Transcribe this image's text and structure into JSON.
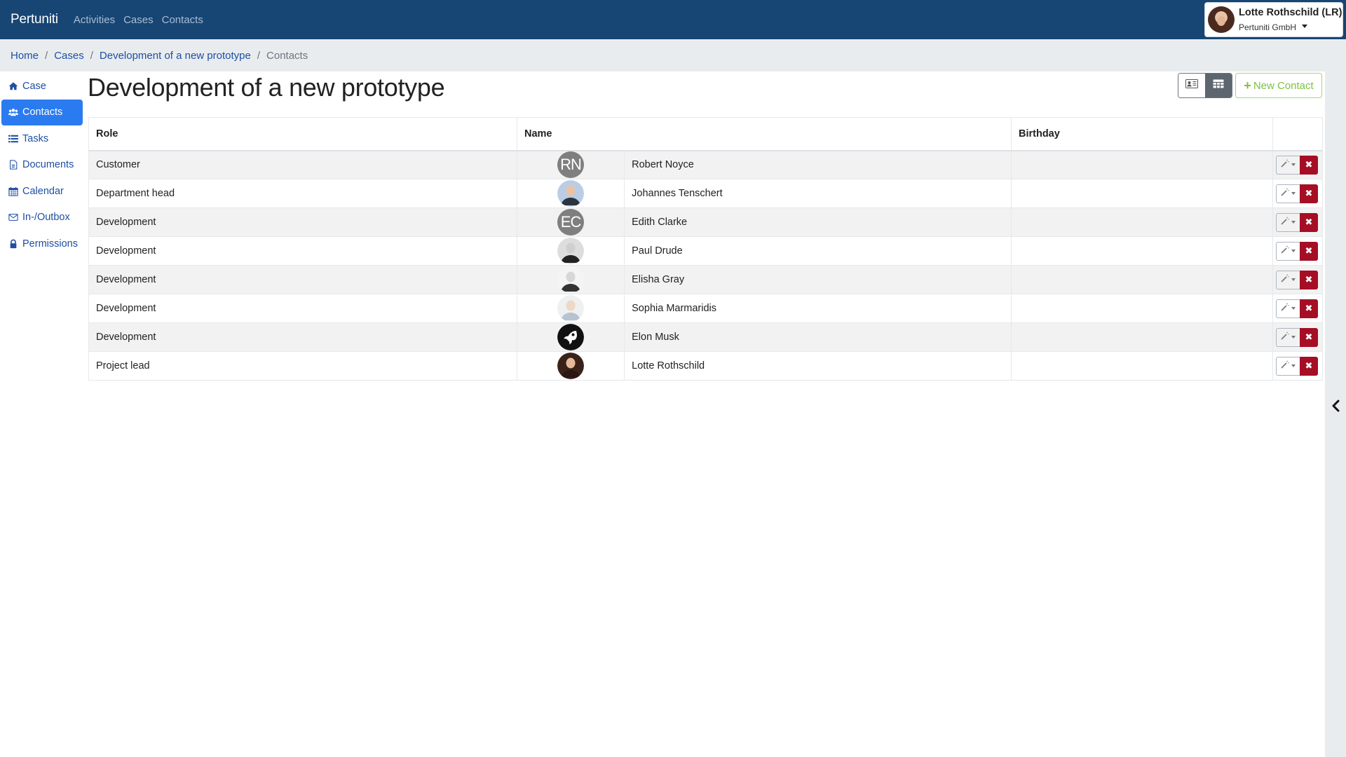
{
  "navbar": {
    "brand": "Pertuniti",
    "links": [
      "Activities",
      "Cases",
      "Contacts"
    ],
    "user": {
      "name": "Lotte Rothschild (LR)",
      "organization": "Pertuniti GmbH"
    }
  },
  "breadcrumb": {
    "items": [
      "Home",
      "Cases",
      "Development of a new prototype"
    ],
    "current": "Contacts",
    "separator": "/"
  },
  "sidebar": {
    "items": [
      {
        "label": "Case",
        "icon": "home-icon",
        "active": false
      },
      {
        "label": "Contacts",
        "icon": "users-icon",
        "active": true
      },
      {
        "label": "Tasks",
        "icon": "list-icon",
        "active": false
      },
      {
        "label": "Documents",
        "icon": "document-icon",
        "active": false
      },
      {
        "label": "Calendar",
        "icon": "calendar-icon",
        "active": false
      },
      {
        "label": "In-/Outbox",
        "icon": "envelope-icon",
        "active": false
      },
      {
        "label": "Permissions",
        "icon": "lock-icon",
        "active": false
      }
    ]
  },
  "main": {
    "title": "Development of a new prototype",
    "view_toggle": {
      "options": [
        "card-view",
        "table-view"
      ],
      "selected": "table-view"
    },
    "new_contact_label": "New Contact",
    "table": {
      "headers": {
        "role": "Role",
        "name": "Name",
        "birthday": "Birthday"
      },
      "rows": [
        {
          "role": "Customer",
          "name": "Robert Noyce",
          "avatar": {
            "type": "initials",
            "text": "RN"
          },
          "birthday": ""
        },
        {
          "role": "Department head",
          "name": "Johannes Tenschert",
          "avatar": {
            "type": "photo",
            "icon": "person-photo"
          },
          "birthday": ""
        },
        {
          "role": "Development",
          "name": "Edith Clarke",
          "avatar": {
            "type": "initials",
            "text": "EC"
          },
          "birthday": ""
        },
        {
          "role": "Development",
          "name": "Paul Drude",
          "avatar": {
            "type": "photo",
            "icon": "person-photo"
          },
          "birthday": ""
        },
        {
          "role": "Development",
          "name": "Elisha Gray",
          "avatar": {
            "type": "photo",
            "icon": "person-photo"
          },
          "birthday": ""
        },
        {
          "role": "Development",
          "name": "Sophia Marmaridis",
          "avatar": {
            "type": "photo",
            "icon": "person-photo"
          },
          "birthday": ""
        },
        {
          "role": "Development",
          "name": "Elon Musk",
          "avatar": {
            "type": "photo",
            "icon": "rocket-icon"
          },
          "birthday": ""
        },
        {
          "role": "Project lead",
          "name": "Lotte Rothschild",
          "avatar": {
            "type": "photo",
            "icon": "person-photo"
          },
          "birthday": ""
        }
      ],
      "row_actions": [
        "edit-menu",
        "delete"
      ]
    }
  },
  "colors": {
    "navbar": "#174574",
    "link": "#1e4fa3",
    "active_sidebar": "#2b7bf0",
    "new_contact": "#7cc242",
    "delete": "#a50e25",
    "breadcrumb_bg": "#e9ecef"
  }
}
